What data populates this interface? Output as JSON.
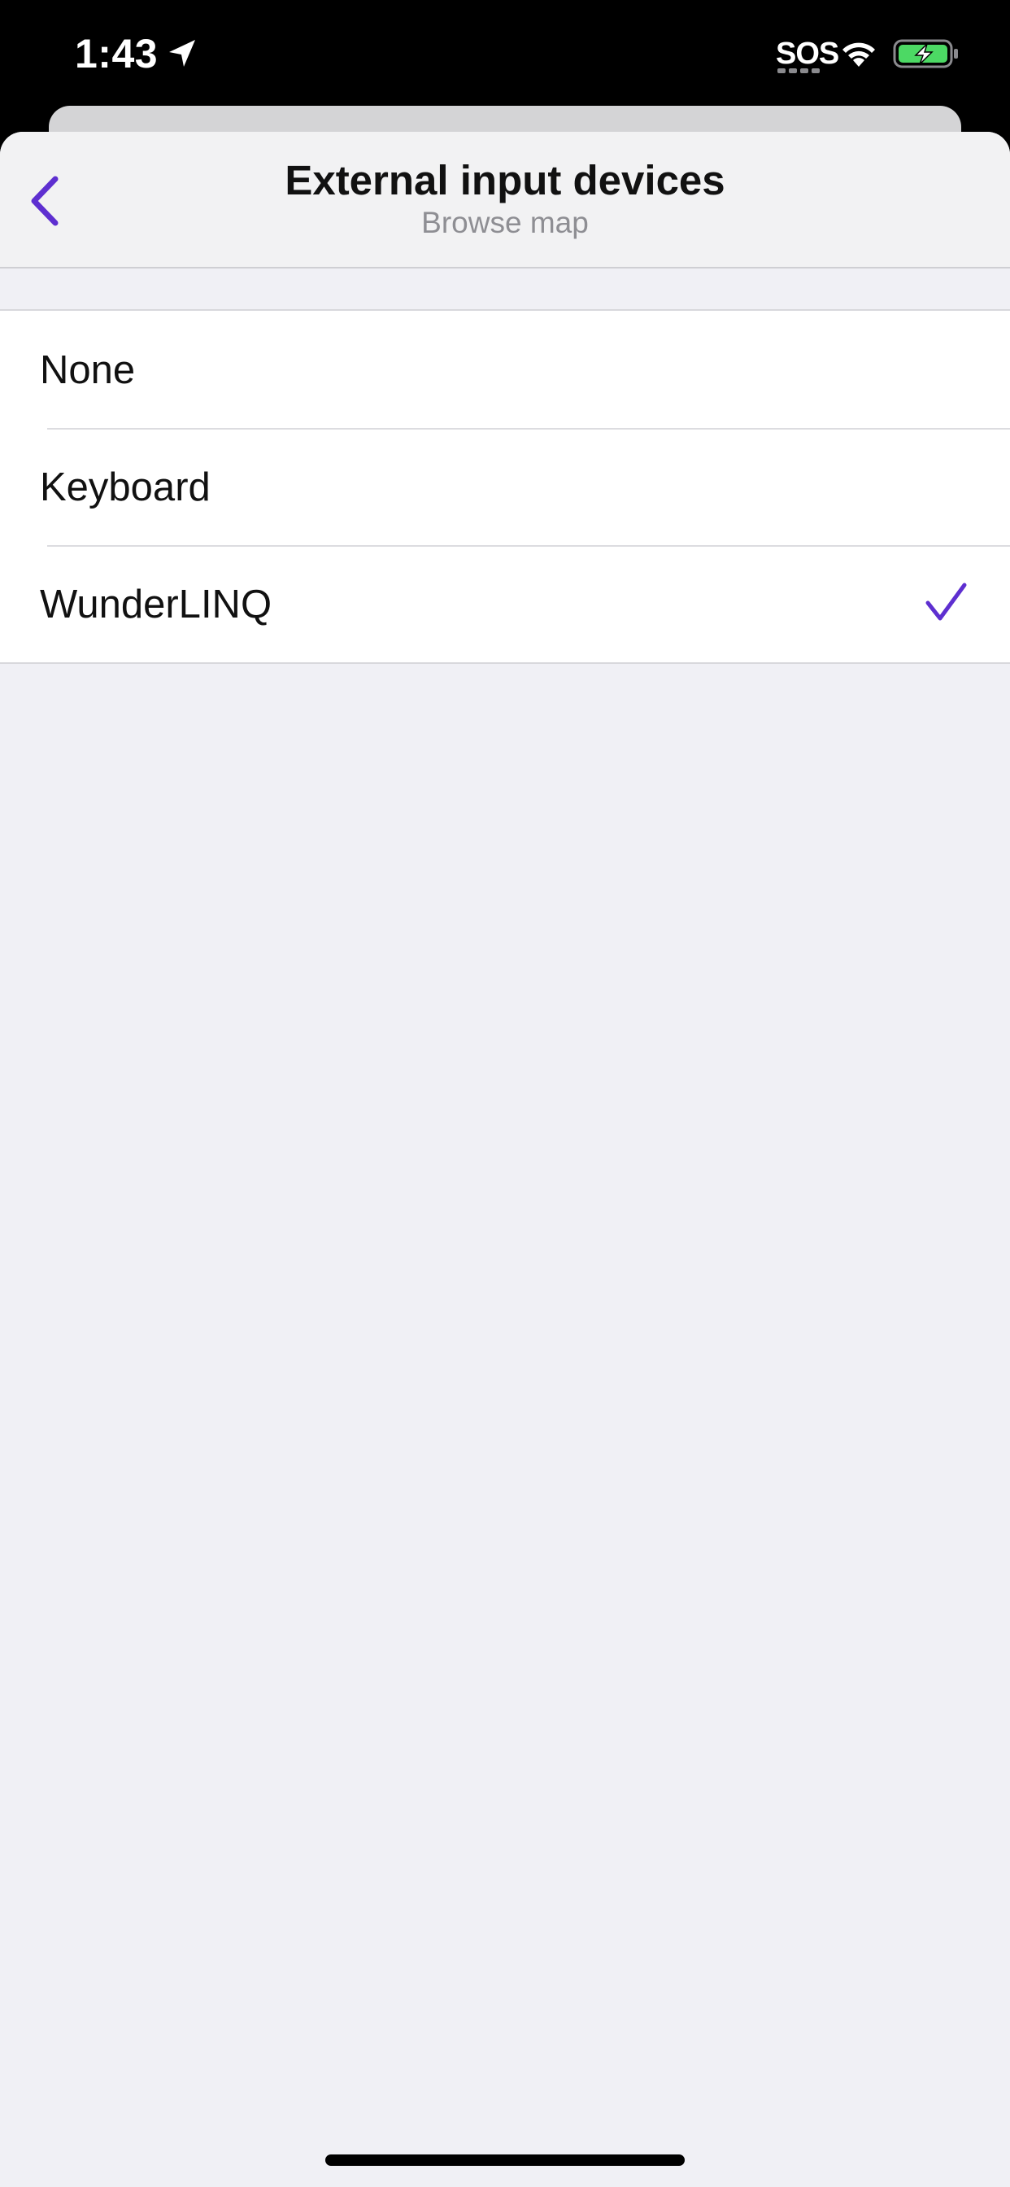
{
  "status_bar": {
    "time": "1:43",
    "sos": "SOS",
    "location_icon": "location-arrow-icon",
    "wifi_icon": "wifi-icon",
    "battery_icon": "battery-charging-icon",
    "battery_color": "#4cd964"
  },
  "nav": {
    "title": "External input devices",
    "subtitle": "Browse map",
    "back_icon": "chevron-left-icon",
    "accent_color": "#5e2fd0"
  },
  "options": {
    "items": [
      {
        "label": "None",
        "selected": false
      },
      {
        "label": "Keyboard",
        "selected": false
      },
      {
        "label": "WunderLINQ",
        "selected": true
      }
    ],
    "selected_icon": "checkmark-icon"
  }
}
